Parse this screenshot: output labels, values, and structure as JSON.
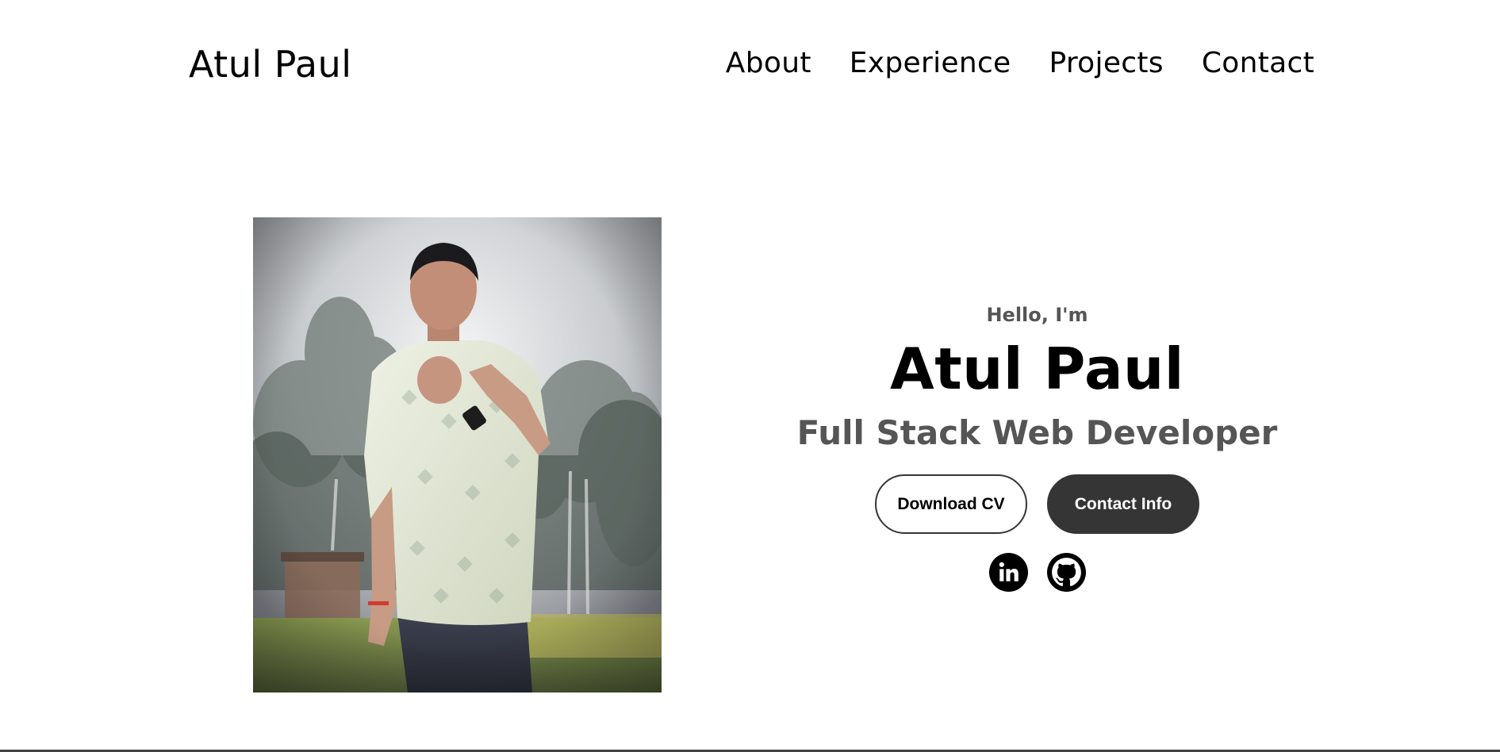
{
  "nav": {
    "logo": "Atul Paul",
    "links": [
      {
        "label": "About"
      },
      {
        "label": "Experience"
      },
      {
        "label": "Projects"
      },
      {
        "label": "Contact"
      }
    ]
  },
  "hero": {
    "greeting": "Hello, I'm",
    "name": "Atul Paul",
    "role": "Full Stack Web Developer",
    "buttons": {
      "download_cv": "Download CV",
      "contact_info": "Contact Info"
    },
    "socials": [
      {
        "icon": "linkedin-icon"
      },
      {
        "icon": "github-icon"
      }
    ],
    "photo_alt": "Profile picture"
  },
  "colors": {
    "text_primary": "#000000",
    "text_secondary": "#555555",
    "button_dark": "#353535",
    "background": "#ffffff"
  }
}
